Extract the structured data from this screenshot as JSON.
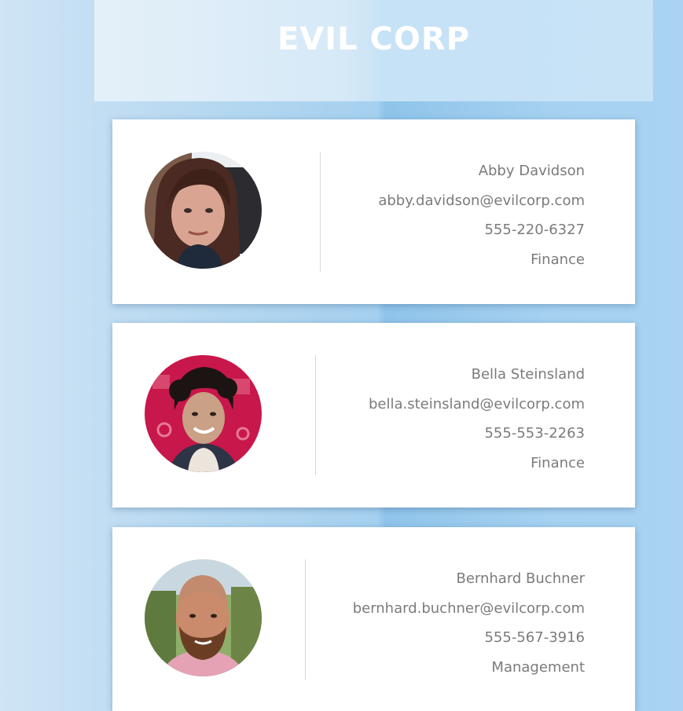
{
  "header": {
    "title": "EVIL CORP"
  },
  "employees": [
    {
      "name": "Abby Davidson",
      "email": "abby.davidson@evilcorp.com",
      "phone": "555-220-6327",
      "department": "Finance"
    },
    {
      "name": "Bella Steinsland",
      "email": "bella.steinsland@evilcorp.com",
      "phone": "555-553-2263",
      "department": "Finance"
    },
    {
      "name": "Bernhard Buchner",
      "email": "bernhard.buchner@evilcorp.com",
      "phone": "555-567-3916",
      "department": "Management"
    }
  ]
}
